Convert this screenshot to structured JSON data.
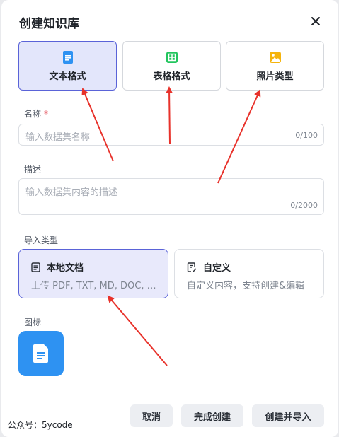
{
  "dialog": {
    "title": "创建知识库"
  },
  "type_options": [
    {
      "label": "文本格式",
      "icon": "text-doc-icon",
      "selected": true,
      "color": "#2e92f2"
    },
    {
      "label": "表格格式",
      "icon": "table-icon",
      "selected": false,
      "color": "#22c55e"
    },
    {
      "label": "照片类型",
      "icon": "image-icon",
      "selected": false,
      "color": "#f5b40c"
    }
  ],
  "name_field": {
    "label": "名称",
    "required_mark": "*",
    "placeholder": "输入数据集名称",
    "counter": "0/100"
  },
  "description_field": {
    "label": "描述",
    "placeholder": "输入数据集内容的描述",
    "counter": "0/2000"
  },
  "import_type": {
    "label": "导入类型",
    "options": [
      {
        "title": "本地文档",
        "description": "上传 PDF, TXT, MD, DOC, …",
        "selected": true
      },
      {
        "title": "自定义",
        "description": "自定义内容，支持创建&编辑",
        "selected": false
      }
    ]
  },
  "icon_field": {
    "label": "图标"
  },
  "footer": {
    "cancel": "取消",
    "finish": "完成创建",
    "create_import": "创建并导入"
  },
  "watermark": "公众号：5ycode",
  "colors": {
    "accent": "#5a63d8",
    "selected_bg": "#e3e6fb",
    "icon_tile": "#2e92f2",
    "annotation_arrow": "#e8322b"
  }
}
